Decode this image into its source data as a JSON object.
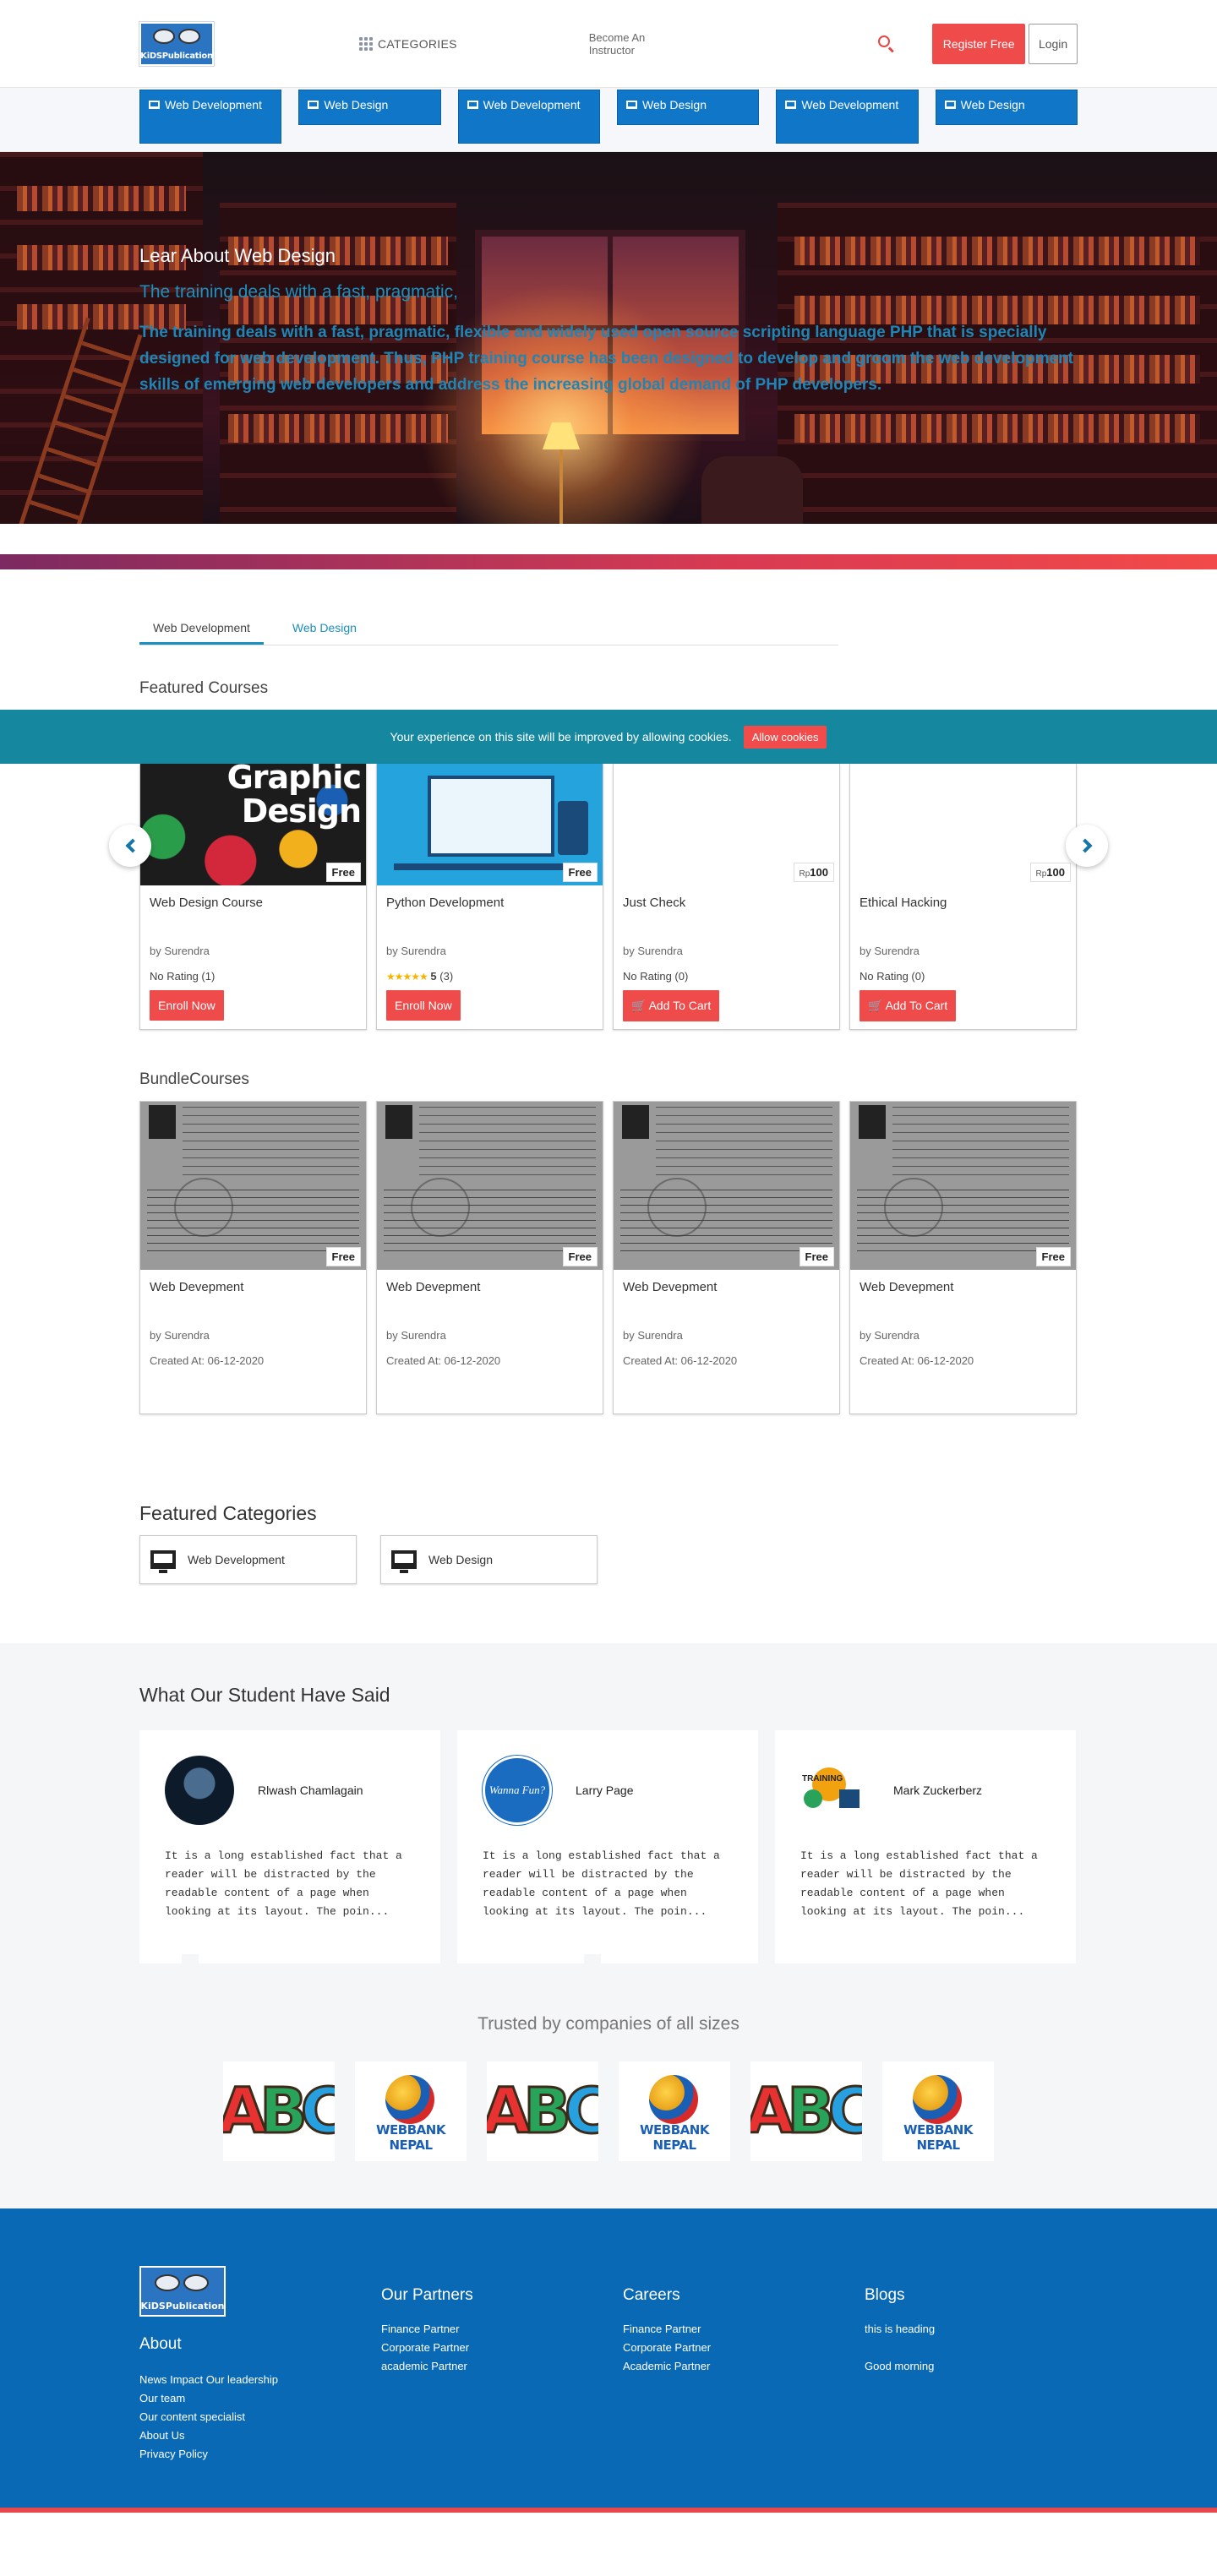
{
  "header": {
    "logo_text": "KiDSPublication",
    "categories_label": "CATEGORIES",
    "instructor_link": "Become An Instructor",
    "register_label": "Register Free",
    "login_label": "Login"
  },
  "category_strip": [
    "Web Development",
    "Web Design",
    "Web Development",
    "Web Design",
    "Web Development",
    "Web Design"
  ],
  "hero": {
    "title": "Lear About Web Design",
    "subtitle": "The training deals with a fast, pragmatic,",
    "description": "The training deals with a fast, pragmatic, flexible and widely used open source scripting language PHP that is specially designed for web development. Thus, PHP training course has been designed to develop and groom the web development skills of emerging web developers and address the increasing global demand of PHP developers."
  },
  "tabs": [
    {
      "label": "Web Development",
      "active": true
    },
    {
      "label": "Web Design",
      "active": false
    }
  ],
  "featured": {
    "title": "Featured Courses",
    "courses": [
      {
        "title": "Web Design Course",
        "author": "by Surendra",
        "badge": "Free",
        "rating_text": "No Rating (1)",
        "action": "Enroll Now",
        "thumb_text_1": "Graphic",
        "thumb_text_2": "Design"
      },
      {
        "title": "Python Development",
        "author": "by Surendra",
        "badge": "Free",
        "rating_value": "5",
        "rating_count": "(3)",
        "action": "Enroll Now"
      },
      {
        "title": "Just Check",
        "author": "by Surendra",
        "price_currency": "Rp",
        "price_value": "100",
        "rating_text": "No Rating (0)",
        "action": "Add To Cart"
      },
      {
        "title": "Ethical Hacking",
        "author": "by Surendra",
        "price_currency": "Rp",
        "price_value": "100",
        "rating_text": "No Rating (0)",
        "action": "Add To Cart"
      }
    ]
  },
  "cookie": {
    "message": "Your experience on this site will be improved by allowing cookies.",
    "button": "Allow cookies"
  },
  "bundles": {
    "title": "BundleCourses",
    "items": [
      {
        "title": "Web Devepment",
        "author": "by Surendra",
        "created": "Created At: 06-12-2020",
        "badge": "Free"
      },
      {
        "title": "Web Devepment",
        "author": "by Surendra",
        "created": "Created At: 06-12-2020",
        "badge": "Free"
      },
      {
        "title": "Web Devepment",
        "author": "by Surendra",
        "created": "Created At: 06-12-2020",
        "badge": "Free"
      },
      {
        "title": "Web Devepment",
        "author": "by Surendra",
        "created": "Created At: 06-12-2020",
        "badge": "Free"
      }
    ]
  },
  "featured_categories": {
    "title": "Featured Categories",
    "items": [
      "Web Development",
      "Web Design"
    ]
  },
  "testimonials": {
    "title": "What Our Student Have Said",
    "items": [
      {
        "name": "Rlwash Chamlagain",
        "quote": "It is a long established fact that a reader will be distracted by the readable content of a page when looking at its layout. The poin..."
      },
      {
        "name": "Larry Page",
        "quote": "It is a long established fact that a reader will be distracted by the readable content of a page when looking at its layout. The poin...",
        "avatar_text": "Wanna Fun?"
      },
      {
        "name": "Mark Zuckerberz",
        "quote": "It is a long established fact that a reader will be distracted by the readable content of a page when looking at its layout. The poin...",
        "avatar_text": "TRAINING"
      }
    ]
  },
  "trusted": {
    "title": "Trusted by companies of all sizes",
    "logos": [
      {
        "type": "abc",
        "text": "ABC"
      },
      {
        "type": "webbank",
        "text": "WEBBANK NEPAL"
      },
      {
        "type": "abc",
        "text": "ABC"
      },
      {
        "type": "webbank",
        "text": "WEBBANK NEPAL"
      },
      {
        "type": "abc",
        "text": "ABC"
      },
      {
        "type": "webbank",
        "text": "WEBBANK NEPAL"
      }
    ]
  },
  "footer": {
    "logo_text": "KiDSPublication",
    "about": {
      "title": "About",
      "links": [
        "News Impact Our leadership",
        "Our team",
        "Our content specialist",
        "About Us",
        "Privacy Policy"
      ]
    },
    "partners": {
      "title": "Our Partners",
      "links": [
        "Finance Partner",
        "Corporate Partner",
        "academic Partner"
      ]
    },
    "careers": {
      "title": "Careers",
      "links": [
        "Finance Partner",
        "Corporate Partner",
        "Academic Partner"
      ]
    },
    "blogs": {
      "title": "Blogs",
      "links": [
        "this is heading",
        "Good morning"
      ]
    }
  },
  "colors": {
    "accent_red": "#ef4b4b",
    "brand_blue": "#1077c8",
    "teal": "#15879f",
    "footer_blue": "#0a69b5"
  }
}
